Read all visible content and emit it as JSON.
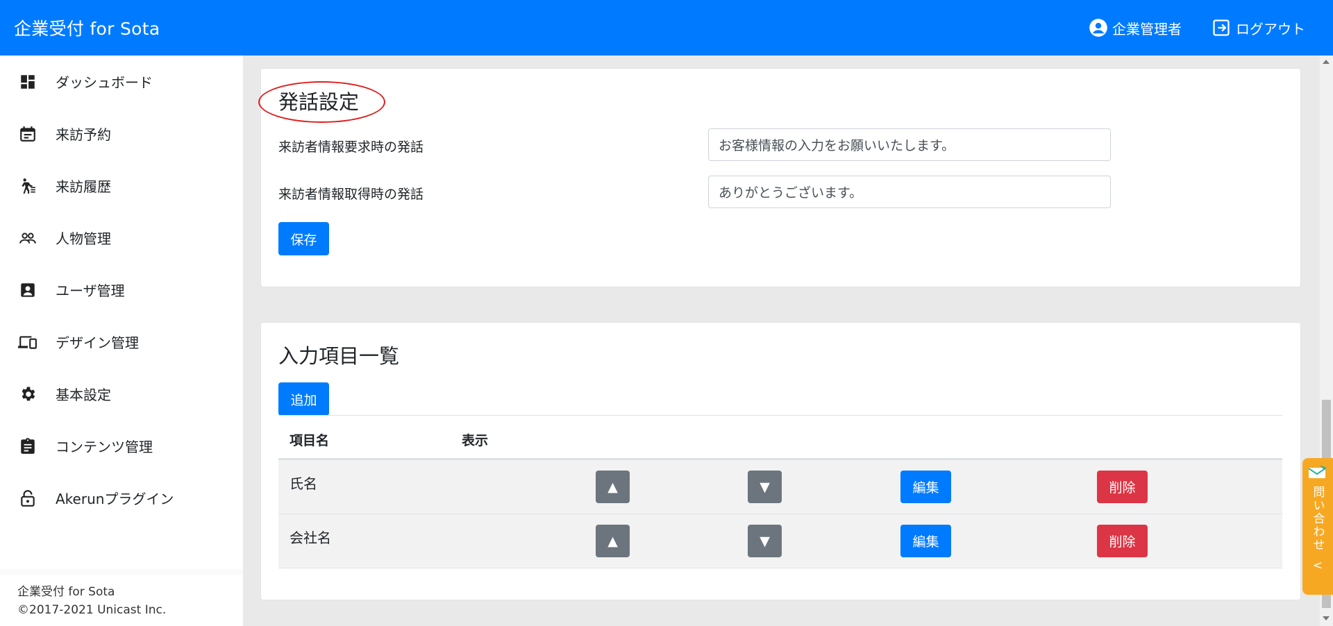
{
  "app": {
    "title": "企業受付 for Sota"
  },
  "header": {
    "user_label": "企業管理者",
    "logout_label": "ログアウト"
  },
  "sidebar": {
    "items": [
      {
        "label": "ダッシュボード",
        "icon": "dashboard-icon"
      },
      {
        "label": "来訪予約",
        "icon": "calendar-icon"
      },
      {
        "label": "来訪履歴",
        "icon": "walking-person-icon"
      },
      {
        "label": "人物管理",
        "icon": "people-icon"
      },
      {
        "label": "ユーザ管理",
        "icon": "account-box-icon"
      },
      {
        "label": "デザイン管理",
        "icon": "devices-icon"
      },
      {
        "label": "基本設定",
        "icon": "gear-icon"
      },
      {
        "label": "コンテンツ管理",
        "icon": "clipboard-icon"
      },
      {
        "label": "Akerunプラグイン",
        "icon": "lock-icon"
      }
    ],
    "footer": {
      "line1": "企業受付 for Sota",
      "line2": "©2017-2021 Unicast Inc."
    }
  },
  "speech_settings": {
    "title": "発話設定",
    "fields": [
      {
        "label": "来訪者情報要求時の発話",
        "value": "お客様情報の入力をお願いいたします。"
      },
      {
        "label": "来訪者情報取得時の発話",
        "value": "ありがとうございます。"
      }
    ],
    "save_label": "保存"
  },
  "input_items": {
    "title": "入力項目一覧",
    "add_label": "追加",
    "columns": [
      "項目名",
      "表示"
    ],
    "rows": [
      {
        "name": "氏名"
      },
      {
        "name": "会社名"
      }
    ],
    "up_label": "▲",
    "down_label": "▼",
    "edit_label": "編集",
    "delete_label": "削除"
  },
  "contact_tab": {
    "label": "問い合わせ",
    "chevron": "<"
  },
  "colors": {
    "primary": "#007bff",
    "secondary": "#6c757d",
    "danger": "#dc3545",
    "contact": "#f7a823",
    "annotation": "#e01e1e"
  }
}
